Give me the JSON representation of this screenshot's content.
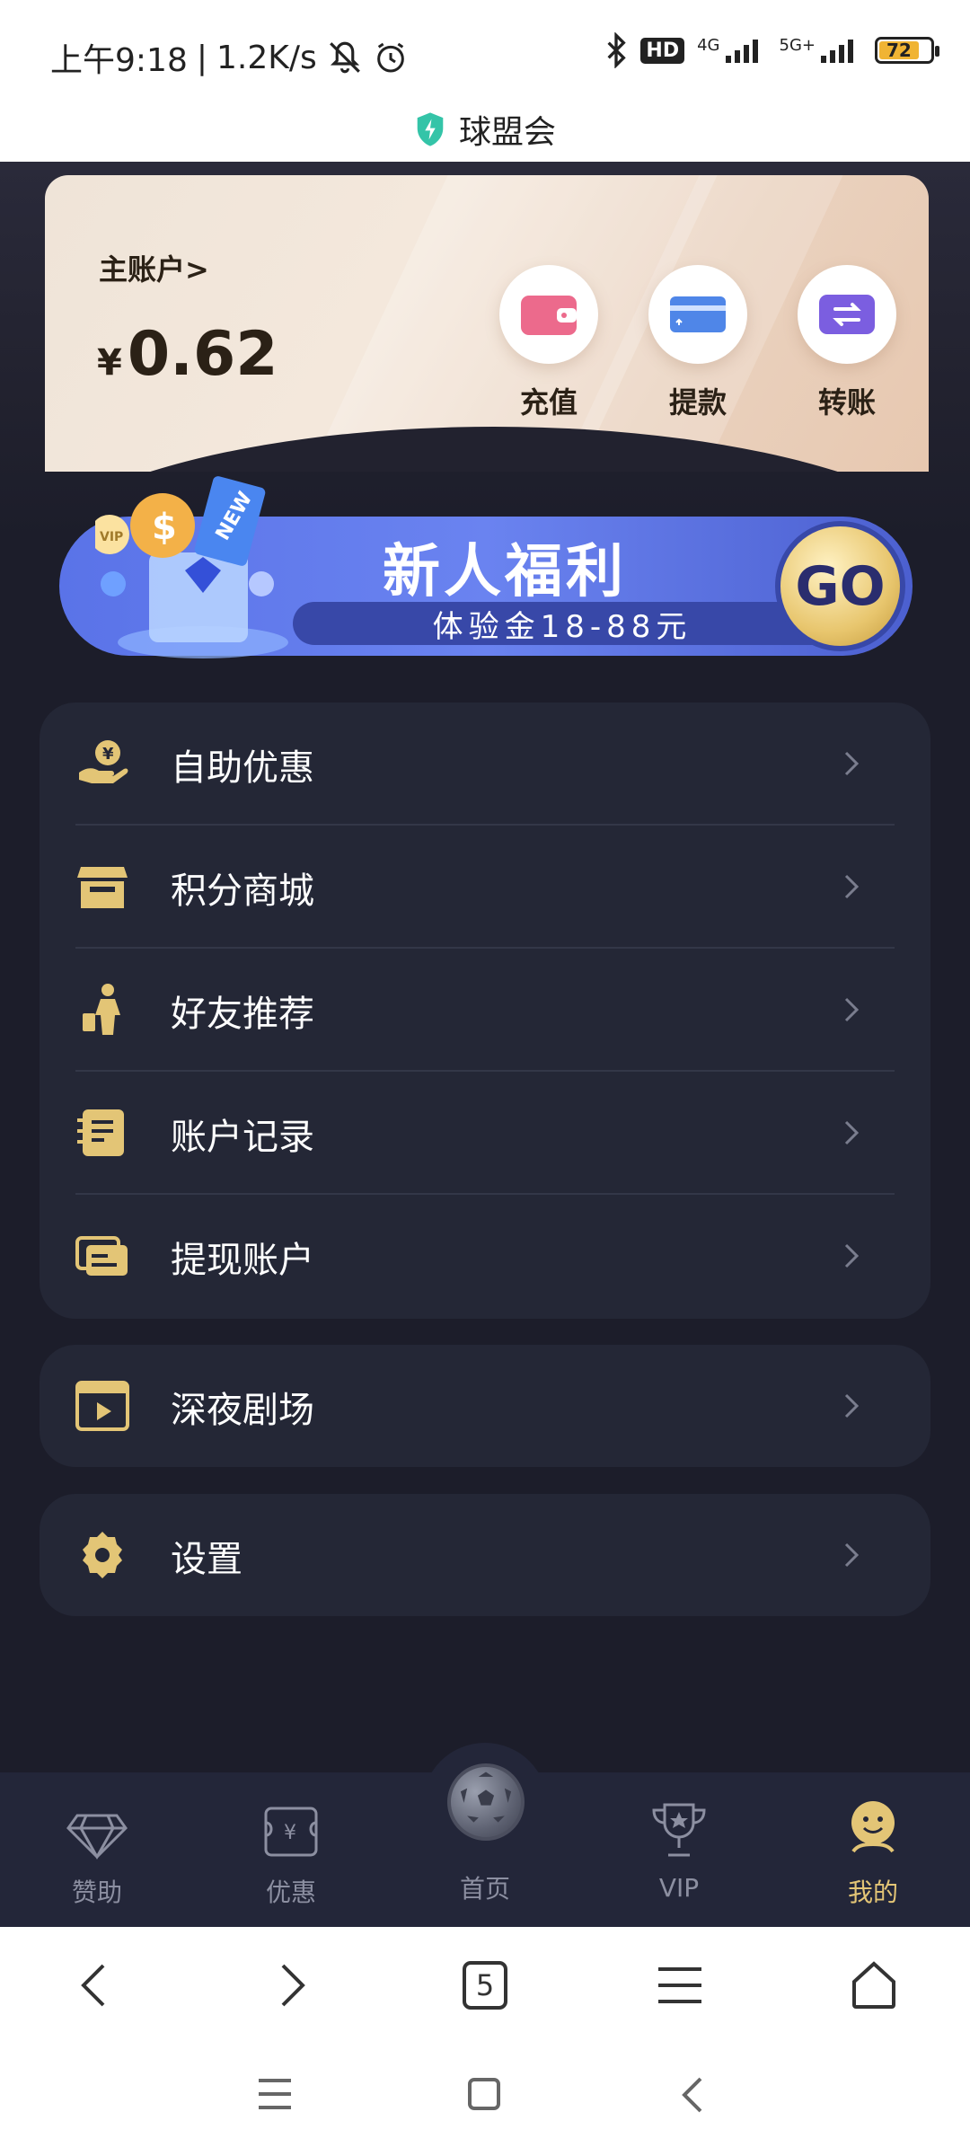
{
  "status_bar": {
    "time": "上午9:18",
    "network_speed": "1.2K/s",
    "battery": "72",
    "network_4g": "4G",
    "network_5g": "5G+",
    "hd": "HD"
  },
  "site": {
    "title": "球盟会"
  },
  "account": {
    "label": "主账户>",
    "currency": "¥",
    "balance": "0.62",
    "actions": [
      {
        "label": "充值",
        "icon": "wallet-icon",
        "color": "#ec6a8c"
      },
      {
        "label": "提款",
        "icon": "card-icon",
        "color": "#4f86e8"
      },
      {
        "label": "转账",
        "icon": "transfer-icon",
        "color": "#7b5ee0"
      }
    ]
  },
  "promo": {
    "title": "新人福利",
    "subtitle": "体验金18-88元",
    "go": "GO",
    "badge": "NEW",
    "vip_badge": "VIP"
  },
  "menu_group1": [
    {
      "label": "自助优惠",
      "icon": "hand-coin-icon"
    },
    {
      "label": "积分商城",
      "icon": "store-icon"
    },
    {
      "label": "好友推荐",
      "icon": "people-icon"
    },
    {
      "label": "账户记录",
      "icon": "notebook-icon"
    },
    {
      "label": "提现账户",
      "icon": "cards-icon"
    }
  ],
  "menu_group2": [
    {
      "label": "深夜剧场",
      "icon": "film-icon"
    }
  ],
  "menu_group3": [
    {
      "label": "设置",
      "icon": "gear-icon"
    }
  ],
  "tabbar": [
    {
      "label": "赞助",
      "icon": "diamond-icon",
      "active": false
    },
    {
      "label": "优惠",
      "icon": "coupon-icon",
      "active": false
    },
    {
      "label": "首页",
      "icon": "soccer-ball-icon",
      "active": false
    },
    {
      "label": "VIP",
      "icon": "trophy-icon",
      "active": false
    },
    {
      "label": "我的",
      "icon": "smiley-icon",
      "active": true
    }
  ],
  "browser_bar": {
    "tab_count": "5"
  },
  "colors": {
    "gold": "#e3c576",
    "card_bg": "#242736",
    "page_bg": "#1c1d2a"
  }
}
